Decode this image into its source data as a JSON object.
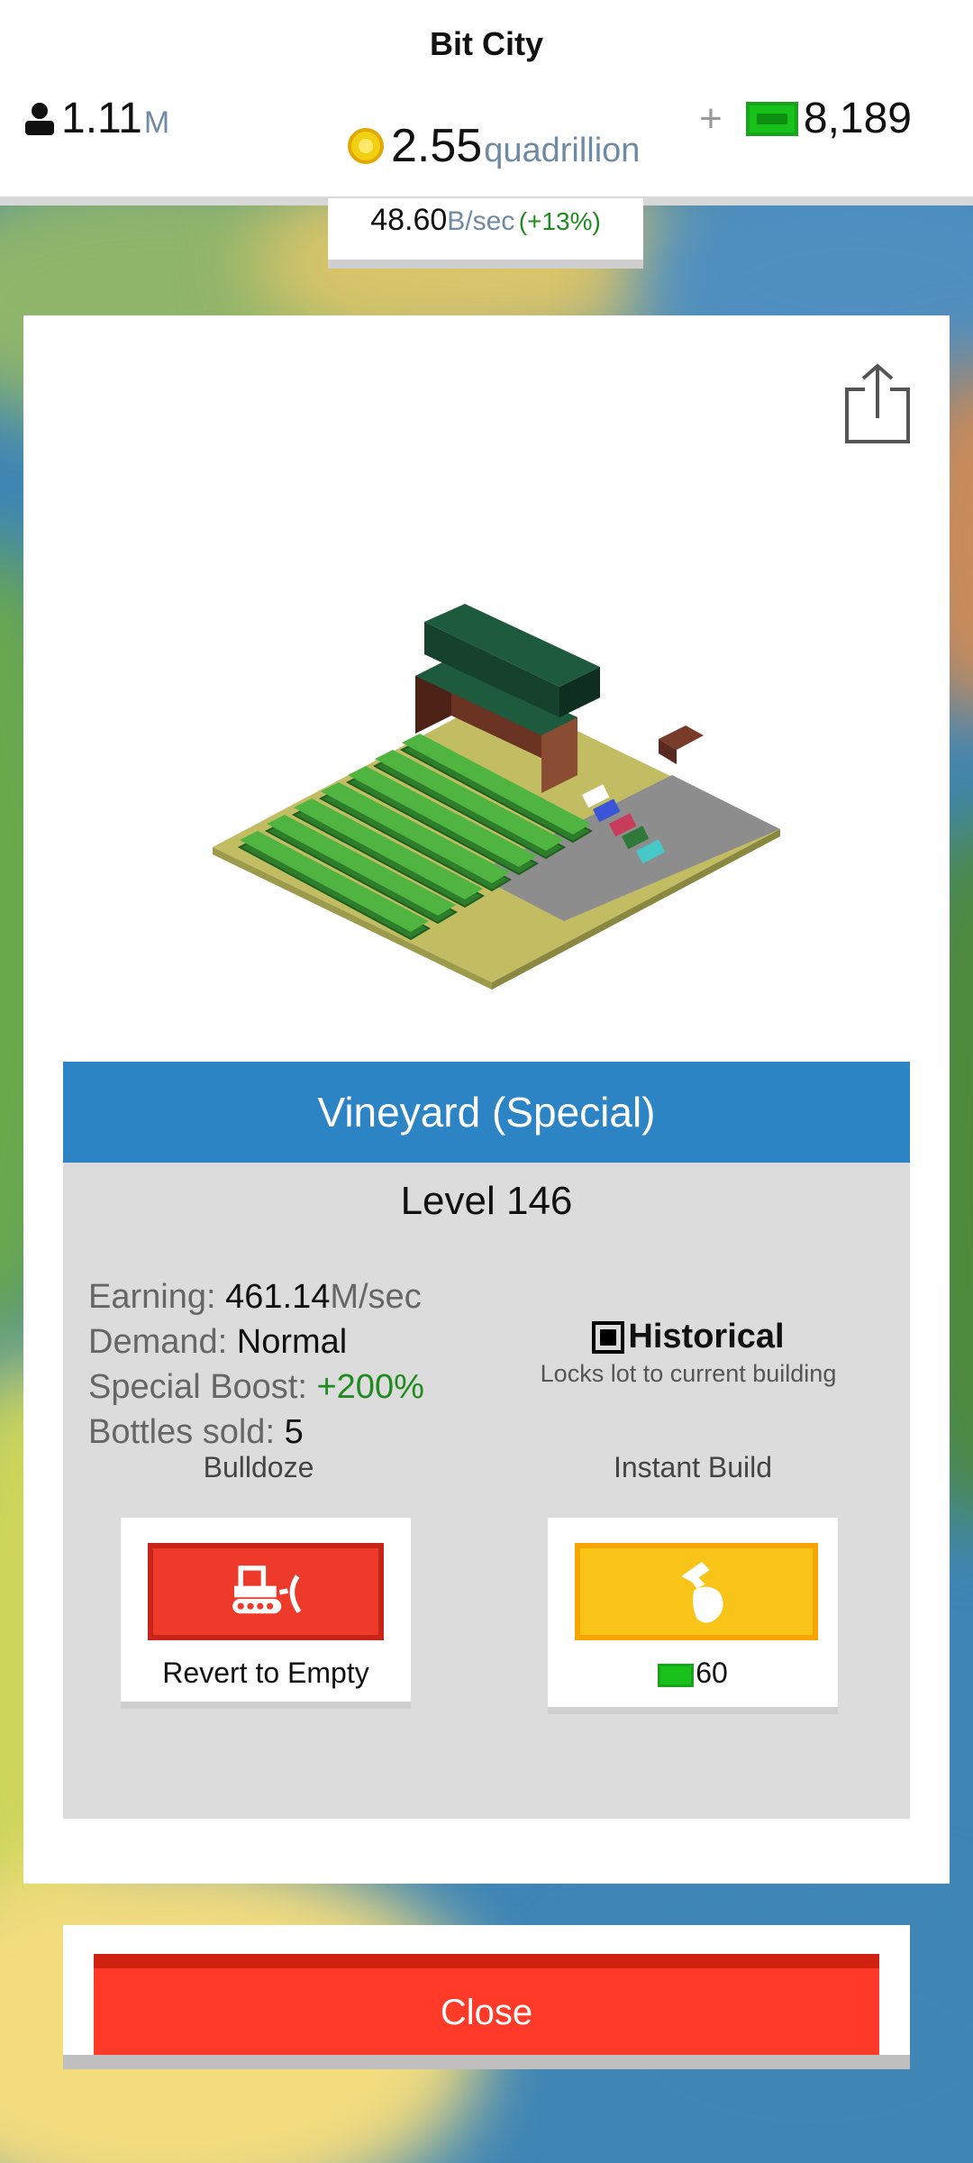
{
  "header": {
    "title": "Bit City",
    "population": {
      "value": "1.11",
      "unit": "M"
    },
    "coins": {
      "value": "2.55",
      "unit": "quadrillion"
    },
    "cash": {
      "plus": "+",
      "value": "8,189"
    },
    "income": {
      "value": "48.60",
      "unit": "B/sec",
      "boost": "(+13%)"
    }
  },
  "building": {
    "name": "Vineyard (Special)",
    "level": "Level 146",
    "stats": {
      "earning_label": "Earning:",
      "earning_value": "461.14",
      "earning_unit": "M/sec",
      "demand_label": "Demand:",
      "demand_value": "Normal",
      "boost_label": "Special Boost:",
      "boost_value": "+200%",
      "sold_label": "Bottles sold:",
      "sold_value": "5"
    },
    "historical": {
      "title": "Historical",
      "subtitle": "Locks lot to current building",
      "checked": true
    }
  },
  "actions": {
    "bulldoze": {
      "label": "Bulldoze",
      "caption": "Revert to Empty",
      "icon": "bulldozer-icon"
    },
    "instant": {
      "label": "Instant Build",
      "cost": "60",
      "icon": "hammer-icon"
    }
  },
  "close_label": "Close",
  "colors": {
    "banner": "#2c84c4",
    "red": "#ee3a2a",
    "yellow": "#f7c417",
    "cash_green": "#18c21a",
    "boost_green": "#1f8a1f"
  }
}
